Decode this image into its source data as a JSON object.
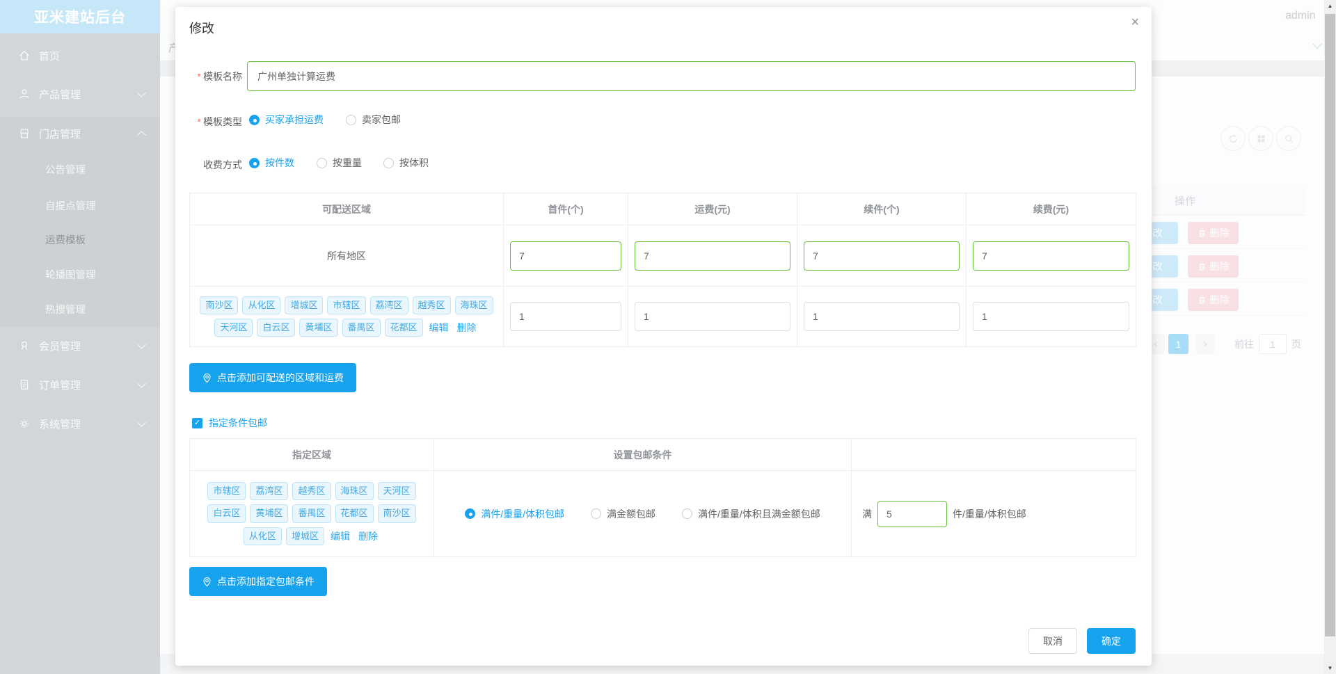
{
  "colors": {
    "accent": "#17a2ee",
    "green_border": "#67c23a",
    "required_red": "#f56c6c",
    "tag_text": "#41a9e3",
    "edit_btn_bg": "#cdeaf9",
    "delete_btn_bg": "#f9e0e5"
  },
  "sidebar": {
    "title": "亚米建站后台",
    "items": [
      {
        "label": "首页",
        "icon": "home-icon"
      },
      {
        "label": "产品管理",
        "icon": "user-icon",
        "chevron": "down"
      },
      {
        "label": "门店管理",
        "icon": "shop-icon",
        "chevron": "up"
      },
      {
        "label": "会员管理",
        "icon": "medal-icon",
        "chevron": "down"
      },
      {
        "label": "订单管理",
        "icon": "order-icon",
        "chevron": "down"
      },
      {
        "label": "系统管理",
        "icon": "gear-icon",
        "chevron": "down"
      }
    ],
    "submenu": [
      "公告管理",
      "自提点管理",
      "运费模板",
      "轮播图管理",
      "热搜管理"
    ],
    "active_submenu": "运费模板"
  },
  "topbar": {
    "admin": "admin",
    "breadcrumb_fragment": "产"
  },
  "background": {
    "ops_header": "操作",
    "edit_button": "修改",
    "delete_button": "删除",
    "pagination": {
      "prev": "‹",
      "active_page": "1",
      "next": "›",
      "goto_label": "前往",
      "goto_value": "1",
      "unit_label": "页"
    }
  },
  "modal": {
    "title": "修改",
    "close": "×",
    "name_field": {
      "required": "*",
      "label": "模板名称",
      "value": "广州单独计算运费"
    },
    "type_field": {
      "required": "*",
      "label": "模板类型",
      "options": [
        {
          "label": "买家承担运费",
          "selected": true
        },
        {
          "label": "卖家包邮",
          "selected": false
        }
      ]
    },
    "fee_field": {
      "label": "收费方式",
      "options": [
        {
          "label": "按件数",
          "selected": true
        },
        {
          "label": "按重量",
          "selected": false
        },
        {
          "label": "按体积",
          "selected": false
        }
      ]
    },
    "region_table": {
      "headers": [
        "可配送区域",
        "首件(个)",
        "运费(元)",
        "续件(个)",
        "续费(元)"
      ],
      "row_all": {
        "region": "所有地区",
        "first": "7",
        "fee": "7",
        "additional": "7",
        "additional_fee": "7"
      },
      "row_districts": {
        "districts": [
          "南沙区",
          "从化区",
          "增城区",
          "市辖区",
          "荔湾区",
          "越秀区",
          "海珠区",
          "天河区",
          "白云区",
          "黄埔区",
          "番禺区",
          "花都区"
        ],
        "edit": "编辑",
        "delete": "删除",
        "first": "1",
        "fee": "1",
        "additional": "1",
        "additional_fee": "1"
      }
    },
    "add_region_button": "点击添加可配送的区域和运费",
    "free_shipping_checkbox": {
      "checked": true,
      "check_glyph": "✓",
      "label": "指定条件包邮"
    },
    "condition_table": {
      "headers": [
        "指定区域",
        "设置包邮条件"
      ],
      "districts": [
        "市辖区",
        "荔湾区",
        "越秀区",
        "海珠区",
        "天河区",
        "白云区",
        "黄埔区",
        "番禺区",
        "花都区",
        "南沙区",
        "从化区",
        "增城区"
      ],
      "edit": "编辑",
      "delete": "删除",
      "options": [
        {
          "label": "满件/重量/体积包邮",
          "selected": true
        },
        {
          "label": "满金额包邮",
          "selected": false
        },
        {
          "label": "满件/重量/体积且满金额包邮",
          "selected": false
        }
      ],
      "threshold": {
        "prefix": "满",
        "value": "5",
        "suffix": "件/重量/体积包邮"
      }
    },
    "add_condition_button": "点击添加指定包邮条件",
    "footer": {
      "cancel": "取消",
      "confirm": "确定"
    }
  }
}
